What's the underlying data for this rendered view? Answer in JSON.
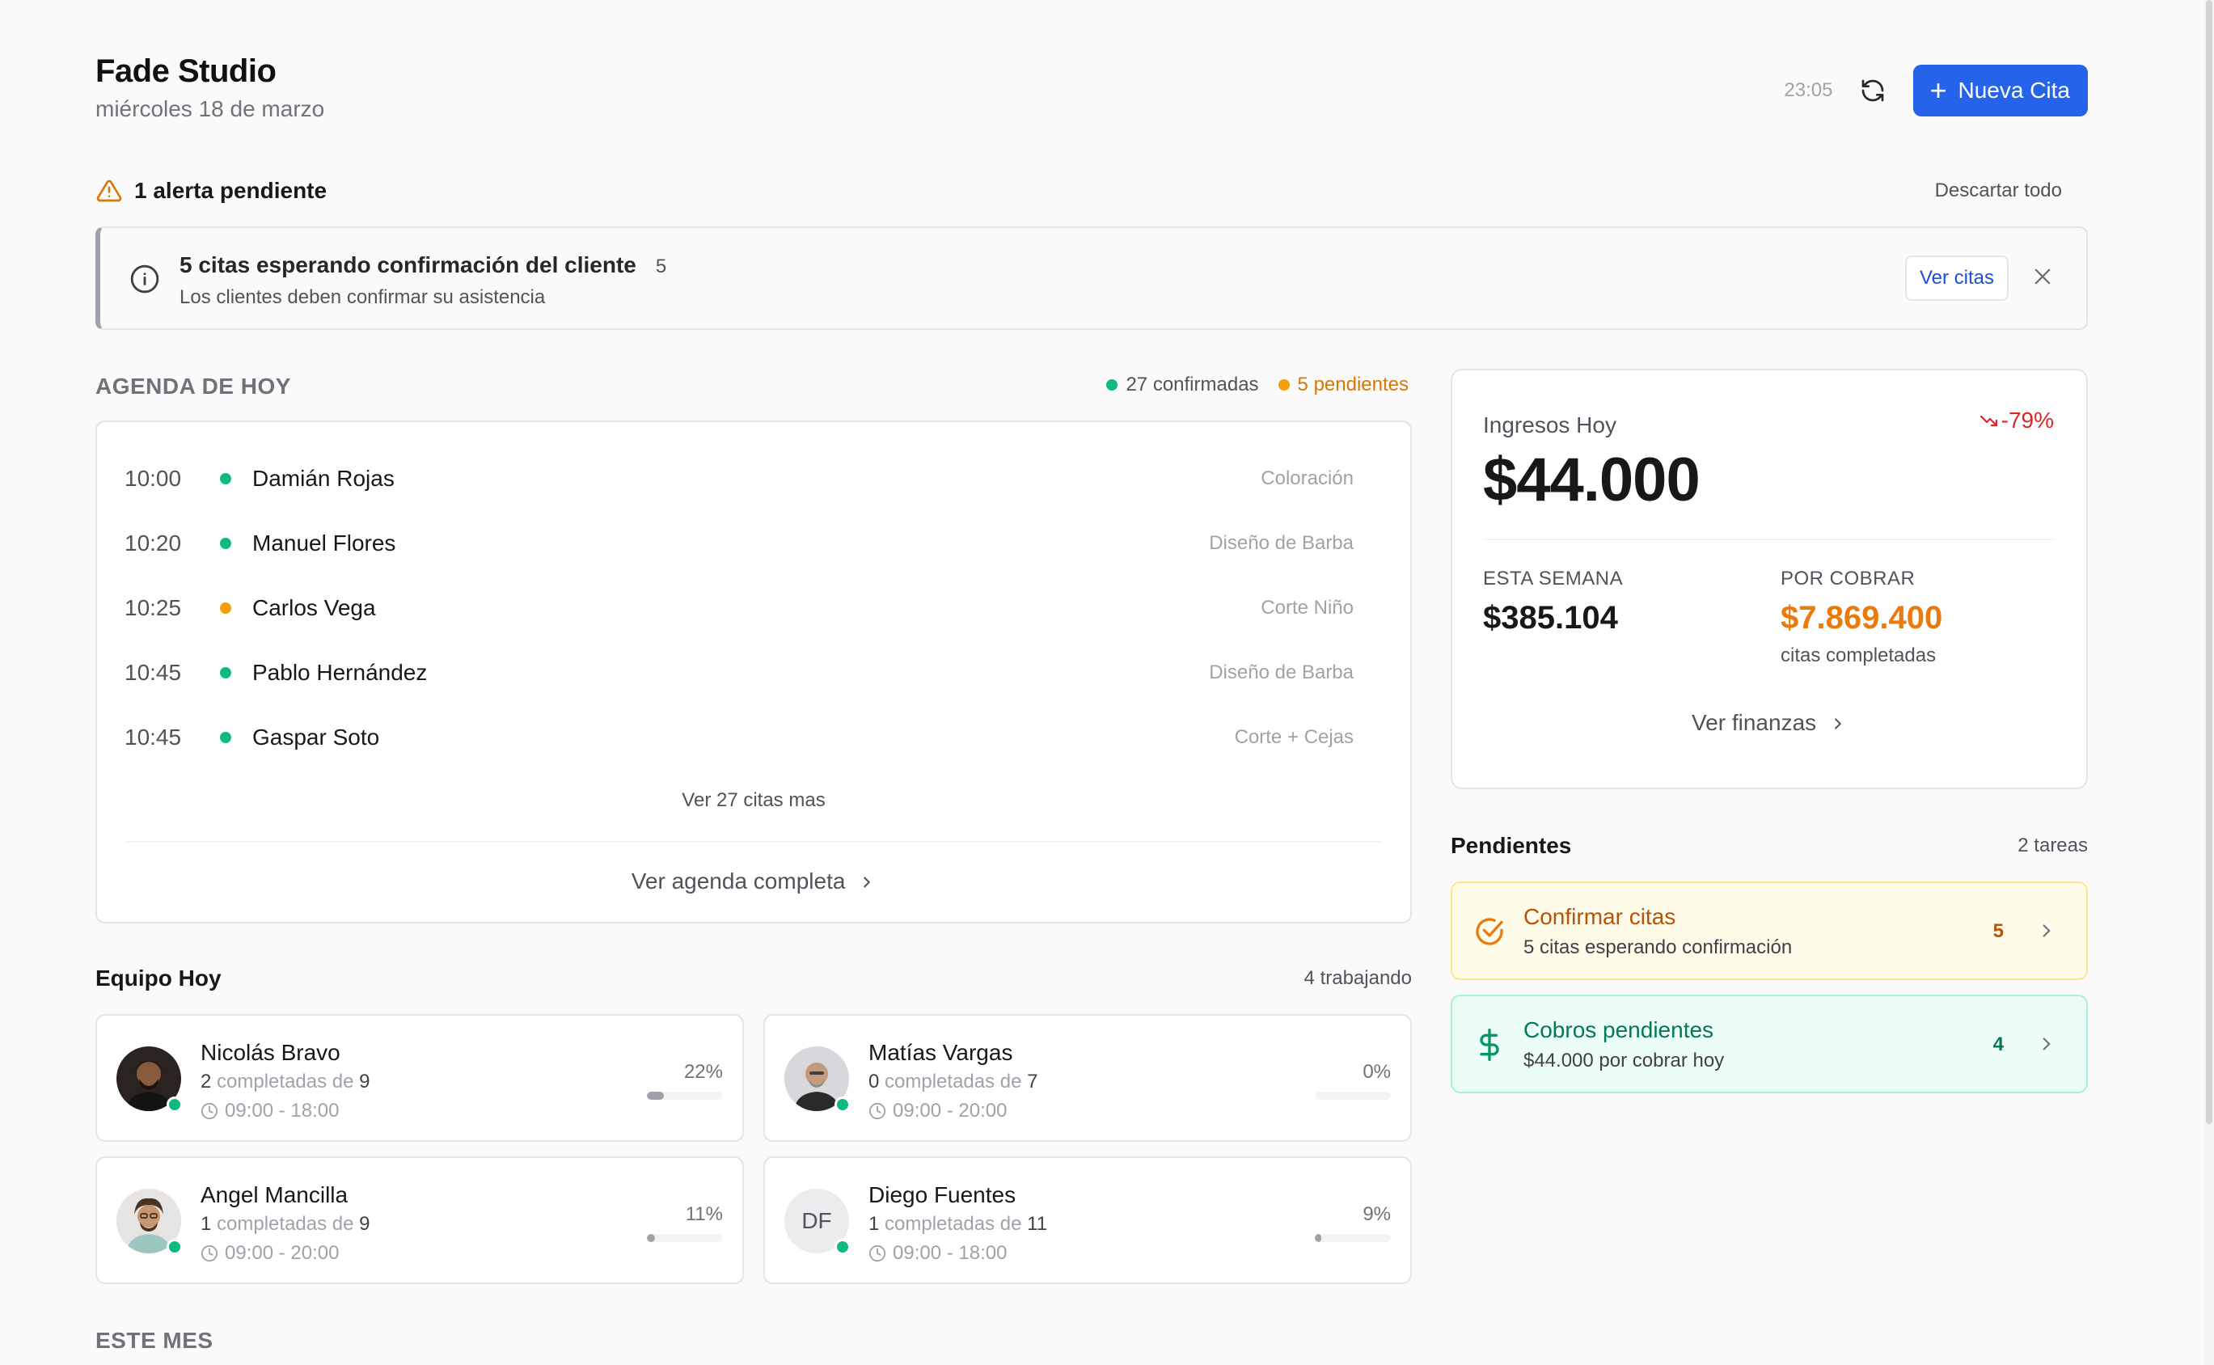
{
  "header": {
    "title": "Fade Studio",
    "date": "miércoles 18 de marzo",
    "clock": "23:05",
    "new_button": "Nueva Cita"
  },
  "alerts": {
    "summary": "1 alerta pendiente",
    "dismiss_all": "Descartar todo",
    "items": [
      {
        "title": "5 citas esperando confirmación del cliente",
        "count": "5",
        "subtitle": "Los clientes deben confirmar su asistencia",
        "action": "Ver citas"
      }
    ]
  },
  "agenda": {
    "label": "AGENDA DE HOY",
    "confirmed": "27 confirmadas",
    "pending": "5 pendientes",
    "items": [
      {
        "time": "10:00",
        "name": "Damián Rojas",
        "service": "Coloración",
        "status": "confirmed"
      },
      {
        "time": "10:20",
        "name": "Manuel Flores",
        "service": "Diseño de Barba",
        "status": "confirmed"
      },
      {
        "time": "10:25",
        "name": "Carlos Vega",
        "service": "Corte Niño",
        "status": "pending"
      },
      {
        "time": "10:45",
        "name": "Pablo Hernández",
        "service": "Diseño de Barba",
        "status": "confirmed"
      },
      {
        "time": "10:45",
        "name": "Gaspar Soto",
        "service": "Corte + Cejas",
        "status": "confirmed"
      }
    ],
    "more": "Ver 27 citas mas",
    "full_link": "Ver agenda completa"
  },
  "finance": {
    "today_label": "Ingresos Hoy",
    "trend": "-79%",
    "today_value": "$44.000",
    "week_label": "ESTA SEMANA",
    "week_value": "$385.104",
    "receivable_label": "POR COBRAR",
    "receivable_value": "$7.869.400",
    "receivable_note": "citas completadas",
    "link": "Ver finanzas"
  },
  "pending": {
    "title": "Pendientes",
    "count": "2 tareas",
    "items": [
      {
        "title": "Confirmar citas",
        "subtitle": "5 citas esperando confirmación",
        "count": "5"
      },
      {
        "title": "Cobros pendientes",
        "subtitle": "$44.000 por cobrar hoy",
        "count": "4"
      }
    ]
  },
  "team": {
    "title": "Equipo Hoy",
    "count": "4 trabajando",
    "completed_word": "completadas de",
    "members": [
      {
        "name": "Nicolás Bravo",
        "done": "2",
        "total": "9",
        "hours": "09:00 - 18:00",
        "pct": "22%",
        "progress": 0.22
      },
      {
        "name": "Matías Vargas",
        "done": "0",
        "total": "7",
        "hours": "09:00 - 20:00",
        "pct": "0%",
        "progress": 0
      },
      {
        "name": "Angel Mancilla",
        "done": "1",
        "total": "9",
        "hours": "09:00 - 20:00",
        "pct": "11%",
        "progress": 0.11
      },
      {
        "name": "Diego Fuentes",
        "initials": "DF",
        "done": "1",
        "total": "11",
        "hours": "09:00 - 18:00",
        "pct": "9%",
        "progress": 0.09
      }
    ]
  },
  "month": {
    "label": "ESTE MES"
  },
  "colors": {
    "accent": "#2563eb",
    "confirmed": "#10b981",
    "pending": "#f59e0b",
    "negative": "#dc2626",
    "receivable": "#ea7a0c"
  }
}
